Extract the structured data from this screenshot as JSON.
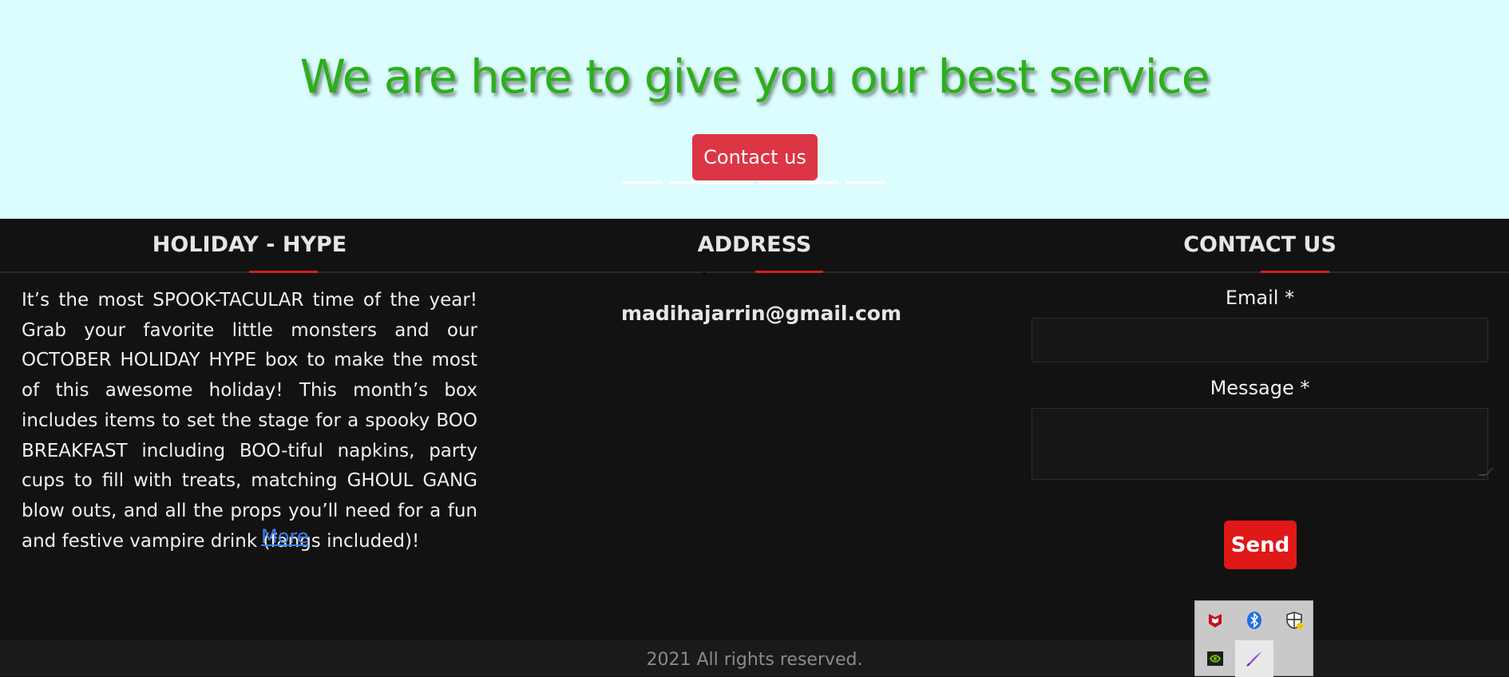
{
  "hero": {
    "title": "We are here to give you our best service",
    "contact_button": "Contact us"
  },
  "footer": {
    "about": {
      "title": "HOLIDAY - HYPE",
      "text": "It’s the most SPOOK-TACULAR time of the year! Grab your favorite little monsters and our OCTOBER HOLIDAY HYPE box to make the most of this awesome holiday! This month’s box includes items to set the stage for a spooky BOO BREAKFAST including BOO-tiful napkins, party cups to fill with treats, matching GHOUL GANG blow outs, and all the props you’ll need for a fun and festive vampire drink (fangs included)!",
      "more_link": "More"
    },
    "address": {
      "title": "ADDRESS",
      "email": "madihajarrin@gmail.com"
    },
    "contact": {
      "title": "CONTACT US",
      "email_label": "Email *",
      "email_value": "",
      "message_label": "Message *",
      "message_value": "",
      "send_button": "Send"
    },
    "copyright": "2021 All rights reserved."
  },
  "system_tray": {
    "icons": [
      "mcafee-icon",
      "bluetooth-icon",
      "security-shield-icon",
      "nvidia-icon",
      "pen-icon"
    ]
  },
  "colors": {
    "hero_background": "#dcfdfd",
    "title_green": "#2bb01a",
    "contact_button": "#dc3545",
    "footer_background": "#121212",
    "accent_red": "#d31f1f",
    "link_blue": "#3d7ff2",
    "send_button": "#e01818"
  }
}
